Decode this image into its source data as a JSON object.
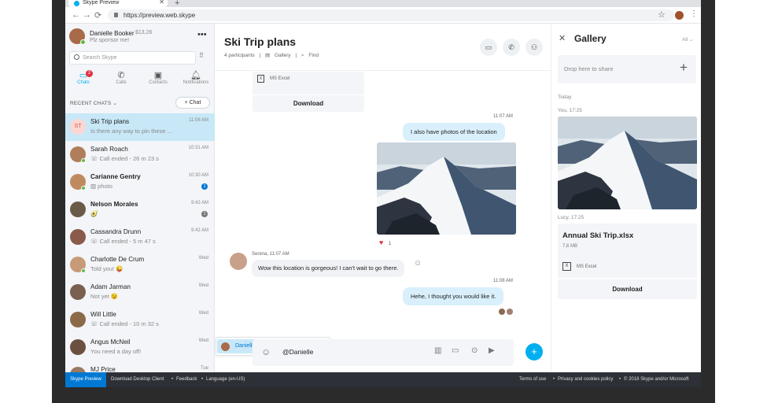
{
  "browser": {
    "tab_title": "Skype Preview",
    "tab_close": "✕",
    "new_tab": "+",
    "url": "https://preview.web.skype"
  },
  "profile": {
    "name": "Danielle Booker",
    "credit": "$13,26",
    "status": "Plz sponsor me!"
  },
  "search": {
    "placeholder": "Search Skype"
  },
  "nav_tabs": [
    {
      "label": "Chats",
      "badge": "2"
    },
    {
      "label": "Calls"
    },
    {
      "label": "Contacts"
    },
    {
      "label": "Notifications"
    }
  ],
  "recent_label": "RECENT CHATS",
  "new_chat_label": "+ Chat",
  "chats": [
    {
      "initials": "ST",
      "name": "Ski Trip plans",
      "preview": "Is there any way to pin these ...",
      "time": "11:08 AM",
      "bold": false,
      "active": true
    },
    {
      "name": "Sarah Roach",
      "preview": "Call ended - 26 m 23 s",
      "time": "10:31 AM",
      "bold": false,
      "online": true,
      "avatar_color": "#b07e5a"
    },
    {
      "name": "Carianne Gentry",
      "preview": "photo",
      "time": "10:30 AM",
      "bold": true,
      "online": true,
      "unread": "1",
      "avatar_color": "#c08a60"
    },
    {
      "name": "Nelson Morales",
      "preview": "🥑",
      "time": "9:42 AM",
      "bold": true,
      "unread": "1",
      "avatar_color": "#6a5a48"
    },
    {
      "name": "Cassandra Drunn",
      "preview": "Call ended - 5 m 47 s",
      "time": "9:42 AM",
      "bold": false,
      "avatar_color": "#8a5a4a"
    },
    {
      "name": "Charlotte De Crum",
      "preview": "Told you! 😜",
      "time": "Wed",
      "bold": false,
      "online": true,
      "avatar_color": "#c79a78"
    },
    {
      "name": "Adam Jarman",
      "preview": "Not yet 😉",
      "time": "Wed",
      "bold": false,
      "avatar_color": "#7a6050"
    },
    {
      "name": "Will Little",
      "preview": "Call ended - 10 m 32 s",
      "time": "Wed",
      "bold": false,
      "avatar_color": "#8b6a4a"
    },
    {
      "name": "Angus McNeil",
      "preview": "You need a day off!",
      "time": "Wed",
      "bold": false,
      "avatar_color": "#6b5040"
    },
    {
      "name": "MJ Price",
      "preview": "",
      "time": "Tue",
      "bold": false,
      "avatar_color": "#9a7a60"
    }
  ],
  "conversation": {
    "title": "Ski Trip plans",
    "participants": "4 participants",
    "gallery": "Gallery",
    "find": "Find"
  },
  "messages": {
    "file_type": "MS Excel",
    "file_download": "Download",
    "time1": "11:07 AM",
    "msg1": "I also have photos of the location",
    "reaction_count": "1",
    "serena_meta": "Serena, 11:07 AM",
    "msg_serena": "Wow this location is gorgeous! I can't wait to go there.",
    "time2": "11:08 AM",
    "msg2": "Hehe, I thought you would like it."
  },
  "mention": {
    "name": "Danielle"
  },
  "composer": {
    "text": "@Danielle"
  },
  "gallery": {
    "title": "Gallery",
    "filter": "All",
    "drop": "Drop here to share",
    "today": "Today",
    "photo_meta": "You, 17:25",
    "file_meta": "Lucy, 17:25",
    "file_name": "Annual Ski Trip.xlsx",
    "file_size": "7,6 MB",
    "file_type": "MS Excel",
    "download": "Download"
  },
  "footer": {
    "preview": "Skype Preview",
    "download": "Download Desktop Client",
    "feedback": "Feedback",
    "language": "Language (en-US)",
    "terms": "Terms of use",
    "privacy": "Privacy and cookies policy",
    "copyright": "© 2018 Skype and/or Microsoft"
  },
  "colors": {
    "accent": "#00aff0",
    "active_chat": "#c8e8f8",
    "outgoing_bubble": "#d9f0fc"
  }
}
